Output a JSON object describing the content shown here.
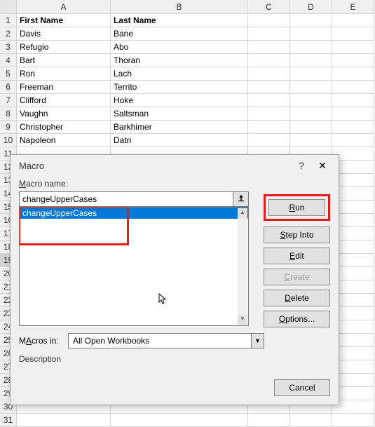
{
  "columns": [
    "A",
    "B",
    "C",
    "D",
    "E"
  ],
  "rows": [
    {
      "n": "1",
      "a": "First Name",
      "b": "Last Name",
      "header": true
    },
    {
      "n": "2",
      "a": "Davis",
      "b": "Bane"
    },
    {
      "n": "3",
      "a": "Refugio",
      "b": "Abo"
    },
    {
      "n": "4",
      "a": "Bart",
      "b": "Thoran"
    },
    {
      "n": "5",
      "a": "Ron",
      "b": "Lach"
    },
    {
      "n": "6",
      "a": "Freeman",
      "b": "Territo"
    },
    {
      "n": "7",
      "a": "Clifford",
      "b": "Hoke"
    },
    {
      "n": "8",
      "a": "Vaughn",
      "b": "Saltsman"
    },
    {
      "n": "9",
      "a": "Christopher",
      "b": "Barkhimer"
    },
    {
      "n": "10",
      "a": "Napoleon",
      "b": "Datri"
    },
    {
      "n": "11"
    },
    {
      "n": "12"
    },
    {
      "n": "13"
    },
    {
      "n": "14"
    },
    {
      "n": "15"
    },
    {
      "n": "16"
    },
    {
      "n": "17"
    },
    {
      "n": "18"
    },
    {
      "n": "19",
      "sel": true
    },
    {
      "n": "20"
    },
    {
      "n": "21"
    },
    {
      "n": "22"
    },
    {
      "n": "23"
    },
    {
      "n": "24"
    },
    {
      "n": "25"
    },
    {
      "n": "26"
    },
    {
      "n": "27"
    },
    {
      "n": "28"
    },
    {
      "n": "29"
    },
    {
      "n": "30"
    },
    {
      "n": "31"
    }
  ],
  "dialog": {
    "title": "Macro",
    "help": "?",
    "close": "✕",
    "name_label": "Macro name:",
    "name_value": "changeUpperCases",
    "list_item": "changeUpperCases",
    "macros_in_label": "Macros in:",
    "macros_in_value": "All Open Workbooks",
    "description_label": "Description",
    "buttons": {
      "run": "Run",
      "step_into": "Step Into",
      "edit": "Edit",
      "create": "Create",
      "delete": "Delete",
      "options": "Options...",
      "cancel": "Cancel"
    },
    "underlines": {
      "run": "R",
      "step_into": "S",
      "edit": "E",
      "create": "C",
      "delete": "D",
      "options": "O",
      "name": "M",
      "macros_in": "A"
    }
  }
}
